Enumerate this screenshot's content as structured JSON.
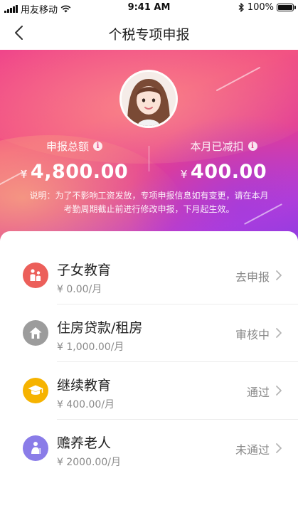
{
  "status_bar": {
    "carrier": "用友移动",
    "time": "9:41 AM",
    "battery": "100%"
  },
  "nav": {
    "title": "个税专项申报"
  },
  "summary": {
    "declared_label": "申报总额",
    "declared_currency": "¥",
    "declared_value": "4,800.00",
    "deducted_label": "本月已减扣",
    "deducted_currency": "¥",
    "deducted_value": "400.00",
    "note": "说明：为了不影响工资发放，专项申报信息如有变更，请在本月考勤周期截止前进行修改申报，下月起生效。"
  },
  "items": [
    {
      "title": "子女教育",
      "amount": "¥ 0.00/月",
      "status": "去申报",
      "icon": "children-icon",
      "color": "#ec5f5a"
    },
    {
      "title": "住房贷款/租房",
      "amount": "¥ 1,000.00/月",
      "status": "审核中",
      "icon": "house-icon",
      "color": "#9c9c9c"
    },
    {
      "title": "继续教育",
      "amount": "¥ 400.00/月",
      "status": "通过",
      "icon": "graduation-cap-icon",
      "color": "#f6b300"
    },
    {
      "title": "赡养老人",
      "amount": "¥ 2000.00/月",
      "status": "未通过",
      "icon": "elder-icon",
      "color": "#8a7ce8"
    }
  ],
  "colors": {
    "accent_pink": "#f0468a",
    "accent_purple": "#8c3be2"
  }
}
